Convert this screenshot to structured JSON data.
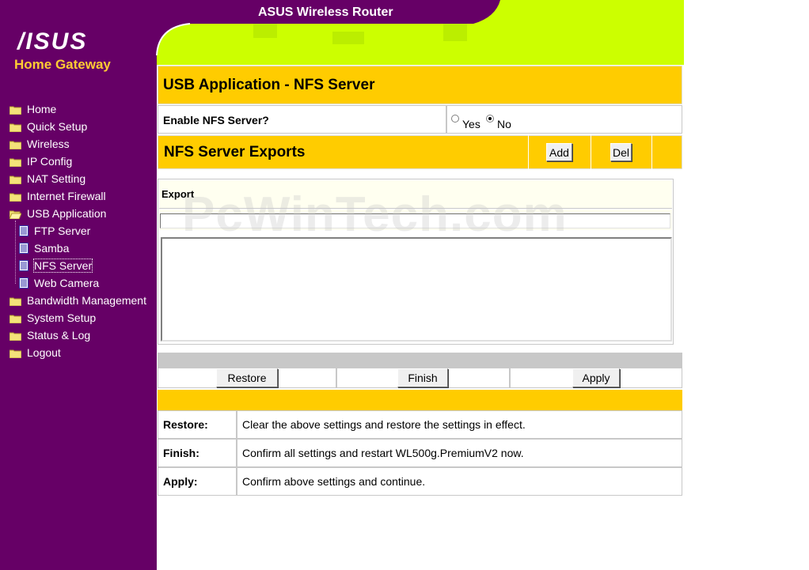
{
  "window": {
    "title": "ASUS Wireless Router"
  },
  "brand": {
    "logo_text": "/ISUS",
    "subtitle": "Home Gateway"
  },
  "sidebar": {
    "items": [
      {
        "label": "Home",
        "icon": "folder-icon"
      },
      {
        "label": "Quick Setup",
        "icon": "folder-icon"
      },
      {
        "label": "Wireless",
        "icon": "folder-icon"
      },
      {
        "label": "IP Config",
        "icon": "folder-icon"
      },
      {
        "label": "NAT Setting",
        "icon": "folder-icon"
      },
      {
        "label": "Internet Firewall",
        "icon": "folder-icon"
      },
      {
        "label": "USB Application",
        "icon": "open-folder-icon"
      },
      {
        "label": "Bandwidth Management",
        "icon": "folder-icon"
      },
      {
        "label": "System Setup",
        "icon": "folder-icon"
      },
      {
        "label": "Status & Log",
        "icon": "folder-icon"
      },
      {
        "label": "Logout",
        "icon": "folder-icon"
      }
    ],
    "subitems": [
      {
        "label": "FTP Server",
        "icon": "page-icon"
      },
      {
        "label": "Samba",
        "icon": "page-icon"
      },
      {
        "label": "NFS Server",
        "icon": "page-icon",
        "selected": true
      },
      {
        "label": "Web Camera",
        "icon": "page-icon"
      }
    ]
  },
  "page": {
    "title": "USB Application - NFS Server",
    "enable_label": "Enable NFS Server?",
    "enable_options": {
      "yes": "Yes",
      "no": "No",
      "selected": "No"
    },
    "exports_title": "NFS Server Exports",
    "add_button": "Add",
    "del_button": "Del",
    "export_header": "Export",
    "export_input_value": ""
  },
  "actions": {
    "restore": "Restore",
    "finish": "Finish",
    "apply": "Apply"
  },
  "help": [
    {
      "label": "Restore:",
      "text": "Clear the above settings and restore the settings in effect."
    },
    {
      "label": "Finish:",
      "text": "Confirm all settings and restart WL500g.PremiumV2 now."
    },
    {
      "label": "Apply:",
      "text": "Confirm above settings and continue."
    }
  ],
  "watermark": "PcWinTech.com",
  "colors": {
    "sidebar": "#660066",
    "header": "#ccff00",
    "band": "#ffcc00",
    "brand_sub": "#ffcc33"
  }
}
